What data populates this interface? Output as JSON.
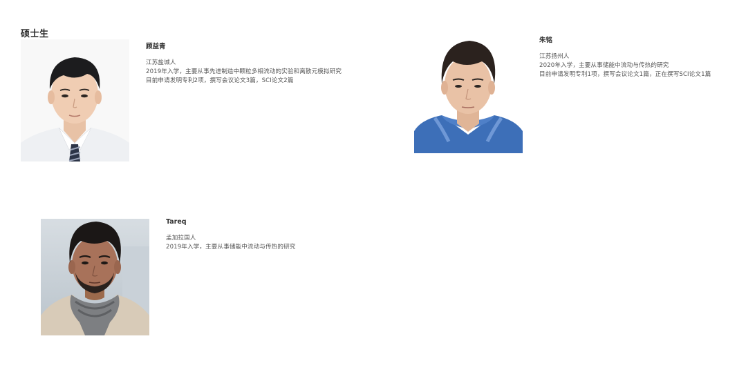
{
  "section": {
    "title": "硕士生"
  },
  "students": [
    {
      "name": "顾益青",
      "origin": "江苏盐城人",
      "detail1": "2019年入学，主要从事先进制造中颗粒多相流动的实验和离散元模拟研究",
      "detail2": "目前申请发明专利2项，撰写会议论文3篇，SCI论文2篇"
    },
    {
      "name": "朱铭",
      "origin": "江苏扬州人",
      "detail1": "2020年入学，主要从事储能中流动与传热的研究",
      "detail2": "目前申请发明专利1项，撰写会议论文1篇，正在撰写SCI论文1篇"
    },
    {
      "name": "Tareq",
      "origin": "孟加拉国人",
      "detail1": "2019年入学，主要从事储能中流动与传热的研究"
    }
  ]
}
